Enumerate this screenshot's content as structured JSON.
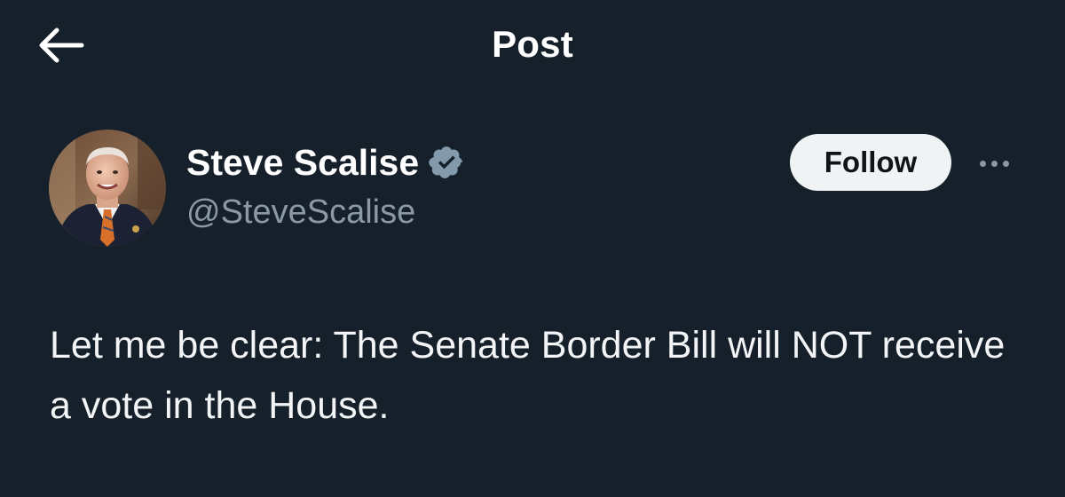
{
  "header": {
    "title": "Post",
    "back_icon": "arrow-left-icon"
  },
  "post": {
    "author": {
      "name": "Steve Scalise",
      "handle": "@SteveScalise",
      "verified_icon": "verified-badge-icon",
      "verified_color": "#829aab"
    },
    "follow_label": "Follow",
    "more_icon": "more-horizontal-icon",
    "text": "Let me be clear: The Senate Border Bill will NOT receive a vote in the House."
  },
  "colors": {
    "background": "#15202b",
    "primary_text": "#ffffff",
    "secondary_text": "#8b98a5",
    "follow_bg": "#eff3f4",
    "follow_text": "#0f1419"
  }
}
